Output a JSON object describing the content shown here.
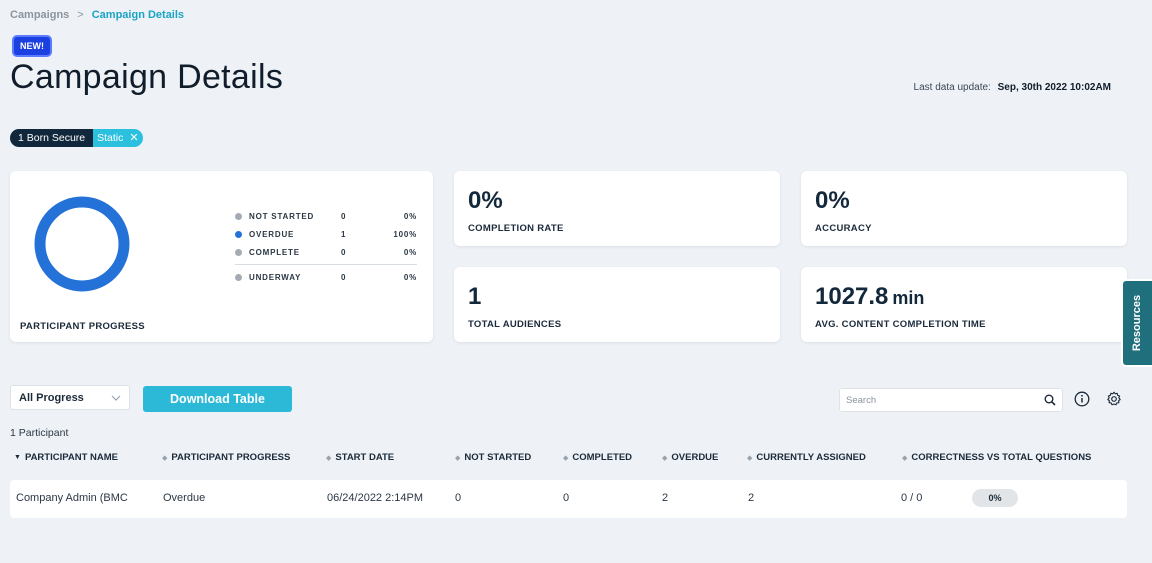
{
  "breadcrumb": {
    "parent": "Campaigns",
    "separator": ">",
    "current": "Campaign Details"
  },
  "badge": {
    "label": "NEW!"
  },
  "page_title": "Campaign Details",
  "last_update": {
    "label": "Last data update:",
    "value": "Sep, 30th 2022 10:02AM"
  },
  "filter_chip": {
    "name": "1 Born Secure",
    "type": "Static"
  },
  "participant_progress": {
    "title": "PARTICIPANT PROGRESS",
    "legend": [
      {
        "label": "NOT STARTED",
        "count": "0",
        "percent": "0%"
      },
      {
        "label": "OVERDUE",
        "count": "1",
        "percent": "100%"
      },
      {
        "label": "COMPLETE",
        "count": "0",
        "percent": "0%"
      },
      {
        "label": "UNDERWAY",
        "count": "0",
        "percent": "0%"
      }
    ],
    "donut_color": "#2471d8"
  },
  "stats": {
    "completion_rate": {
      "value": "0%",
      "label": "COMPLETION RATE"
    },
    "accuracy": {
      "value": "0%",
      "label": "ACCURACY"
    },
    "total_audiences": {
      "value": "1",
      "label": "TOTAL AUDIENCES"
    },
    "avg_completion_time": {
      "value": "1027.8",
      "unit": "min",
      "label": "AVG. CONTENT COMPLETION TIME"
    }
  },
  "resources_tab": {
    "label": "Resources"
  },
  "toolbar": {
    "progress_filter": "All Progress",
    "download_label": "Download Table",
    "search_placeholder": "Search"
  },
  "table": {
    "count_label": "1 Participant",
    "columns": [
      "PARTICIPANT NAME",
      "PARTICIPANT PROGRESS",
      "START DATE",
      "NOT STARTED",
      "COMPLETED",
      "OVERDUE",
      "CURRENTLY ASSIGNED",
      "CORRECTNESS VS TOTAL QUESTIONS"
    ],
    "rows": [
      {
        "name": "Company Admin (BMC",
        "progress": "Overdue",
        "start_date": "06/24/2022 2:14PM",
        "not_started": "0",
        "completed": "0",
        "overdue": "2",
        "currently_assigned": "2",
        "correctness": "0 / 0",
        "correctness_pct": "0%"
      }
    ]
  },
  "colors": {
    "accent": "#2cb9d8",
    "dark": "#11283c",
    "overdue": "#2471d8",
    "resources": "#1f6f7d"
  }
}
